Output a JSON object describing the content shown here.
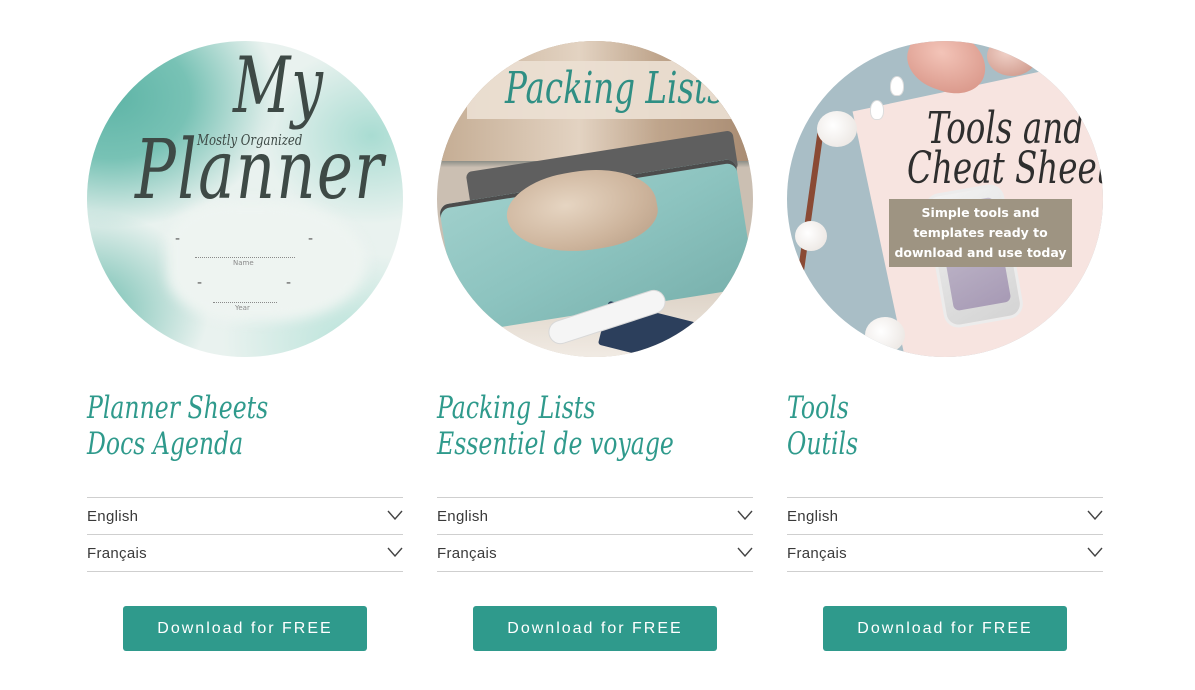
{
  "cards": [
    {
      "image": {
        "type": "planner-cover",
        "title_big_1": "My",
        "subtitle": "Mostly Organized",
        "title_big_2": "Planner",
        "field_1_caption": "Name",
        "field_2_caption": "Year",
        "colors": {
          "wash": "#78c2b5",
          "text": "#3e4a46"
        }
      },
      "title_line_1": "Planner Sheets",
      "title_line_2": "Docs Agenda",
      "accordion": [
        {
          "label": "English"
        },
        {
          "label": "Français"
        }
      ],
      "button_label": "Download for FREE"
    },
    {
      "image": {
        "type": "packing-photo",
        "overlay_title": "Packing Lists"
      },
      "title_line_1": "Packing Lists",
      "title_line_2": "Essentiel de voyage",
      "accordion": [
        {
          "label": "English"
        },
        {
          "label": "Français"
        }
      ],
      "button_label": "Download for FREE"
    },
    {
      "image": {
        "type": "tools-photo",
        "overlay_title_1": "Tools and",
        "overlay_title_2": "Cheat Sheets",
        "overlay_box": "Simple tools and templates ready to download and use today"
      },
      "title_line_1": "Tools",
      "title_line_2": "Outils",
      "accordion": [
        {
          "label": "English"
        },
        {
          "label": "Français"
        }
      ],
      "button_label": "Download for FREE"
    }
  ],
  "icons": {
    "accordion_toggle": "chevron-down-icon"
  },
  "colors": {
    "accent": "#2f9a8c",
    "divider": "#cfcfcf",
    "button_text": "#ffffff"
  }
}
